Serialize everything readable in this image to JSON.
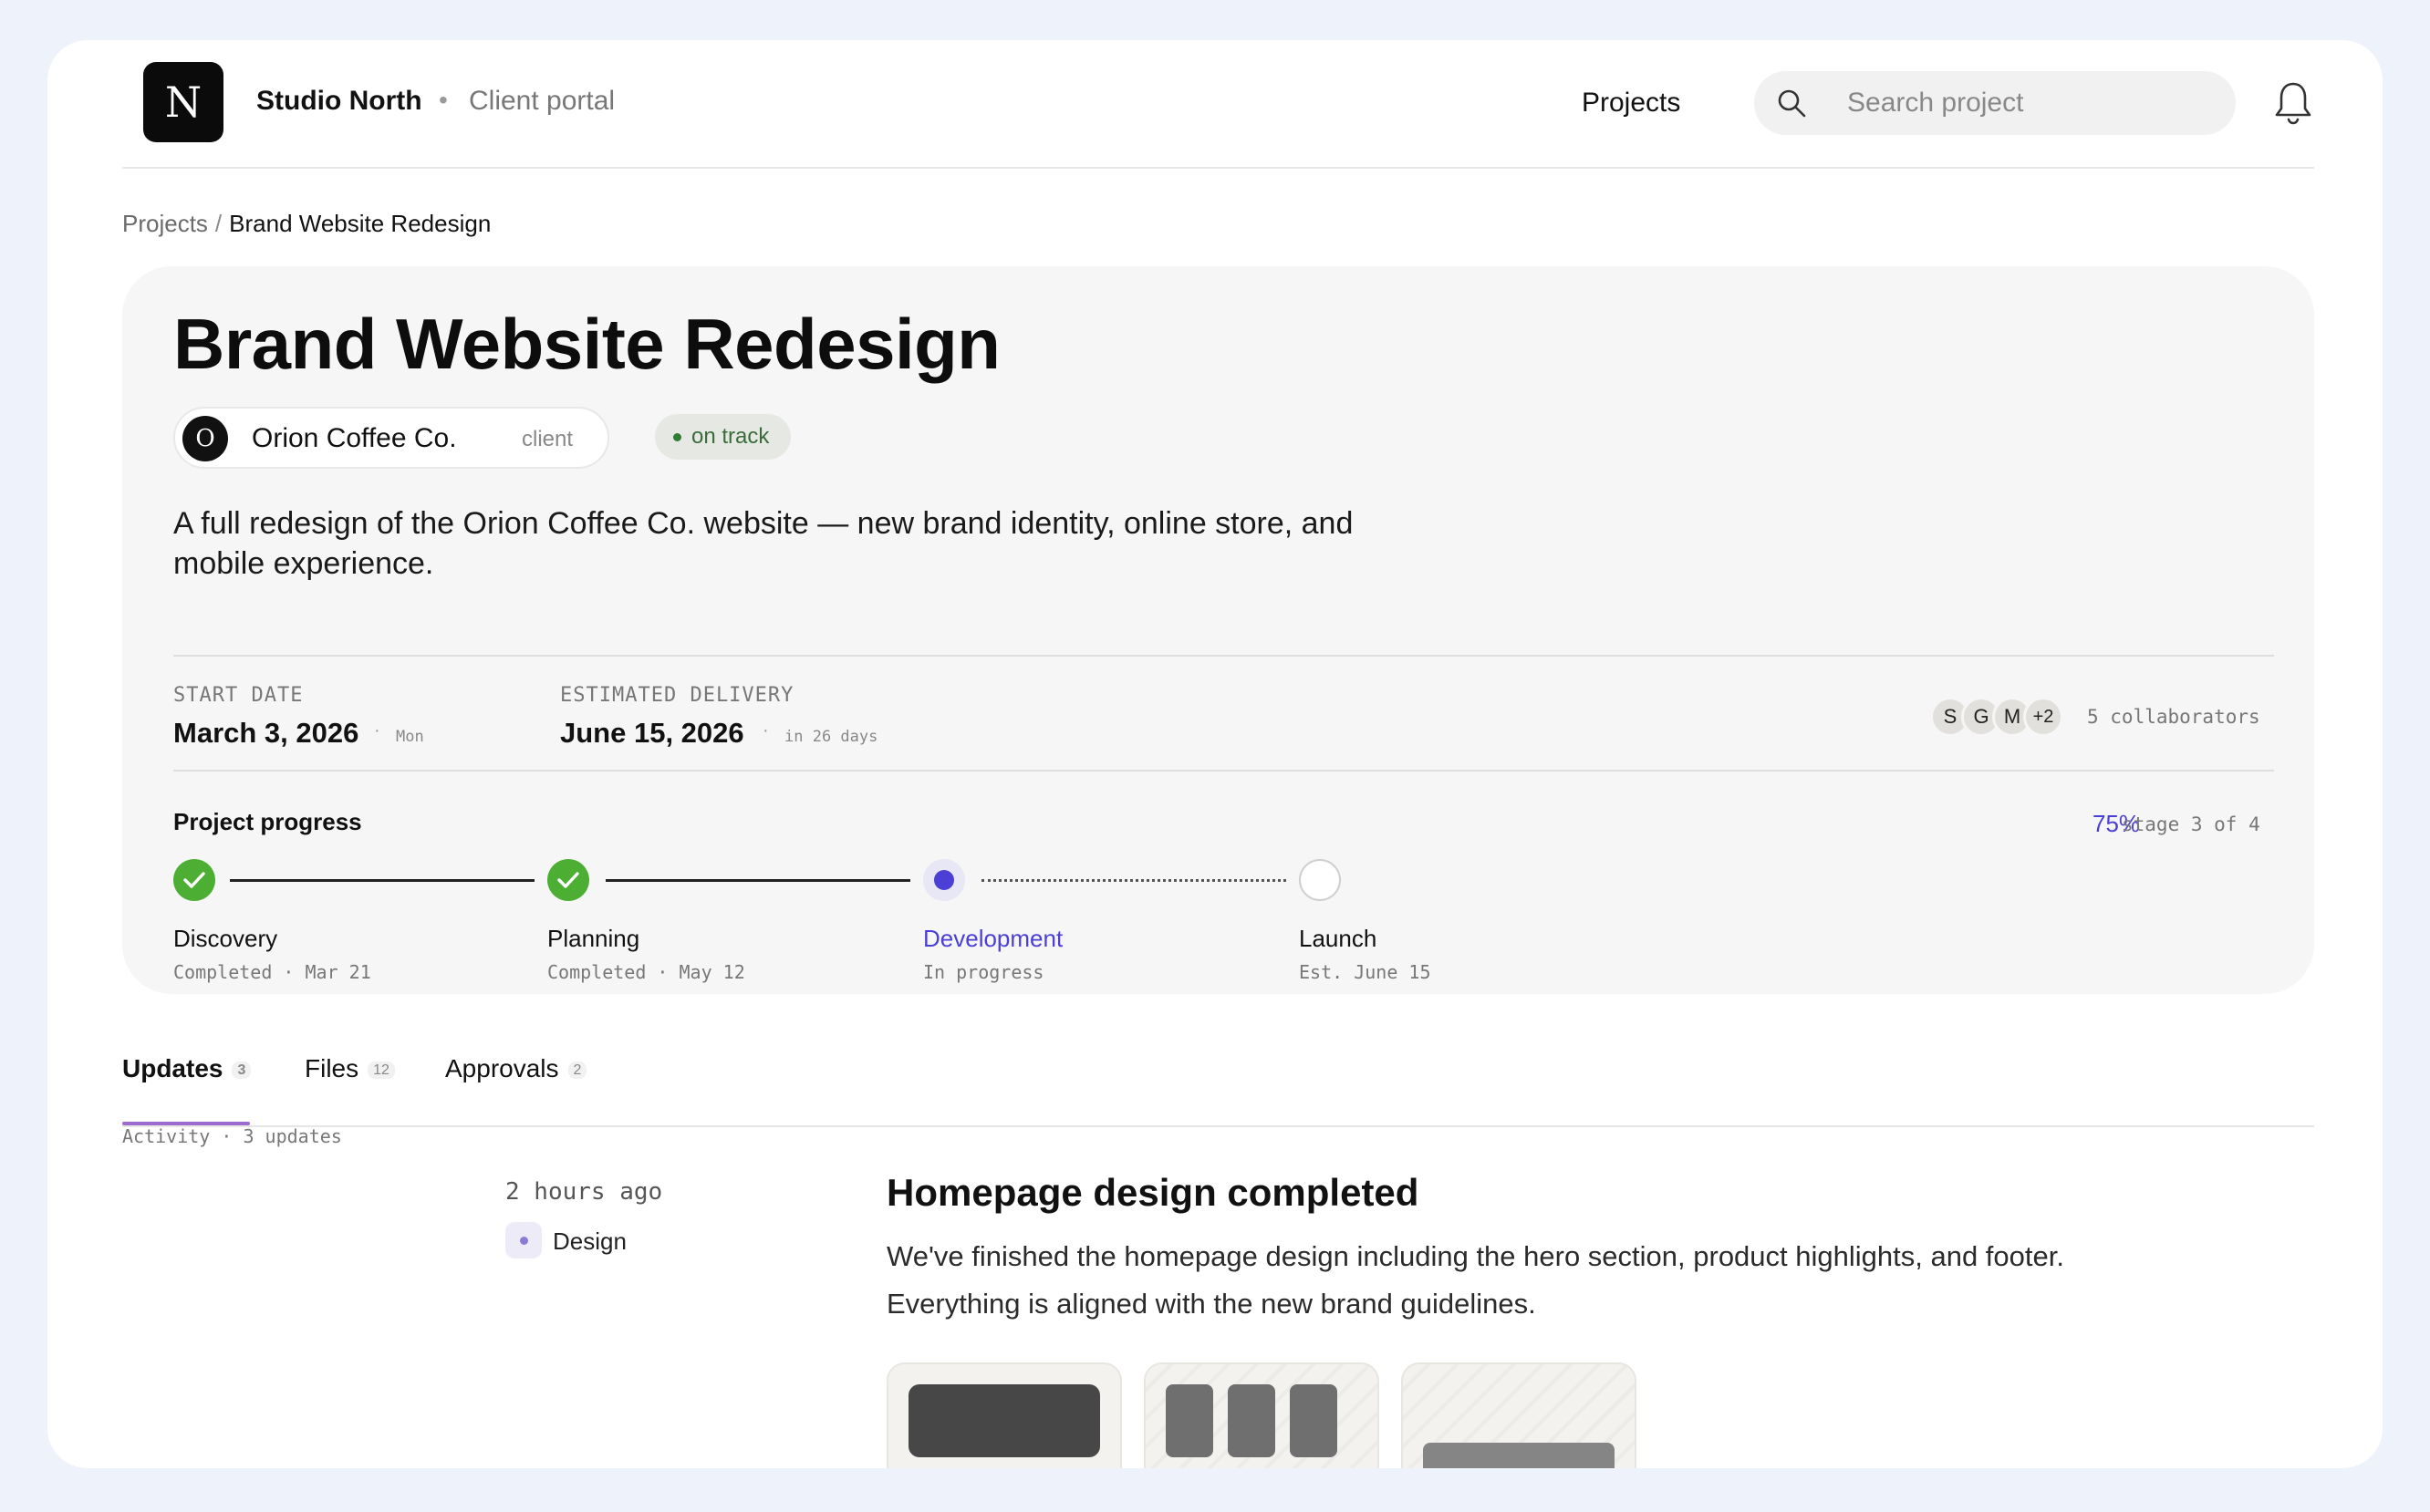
{
  "header": {
    "logo_letter": "N",
    "brand_name": "Studio North",
    "separator": "•",
    "portal_label": "Client portal",
    "nav_projects": "Projects",
    "search_placeholder": "Search project"
  },
  "breadcrumb": {
    "parent": "Projects",
    "separator": "/",
    "current": "Brand Website Redesign"
  },
  "project": {
    "title": "Brand Website Redesign",
    "client": {
      "avatar_letter": "O",
      "name": "Orion Coffee Co.",
      "tag": "client"
    },
    "status": "on track",
    "description": "A full redesign of the Orion Coffee Co. website — new brand identity, online store, and mobile experience.",
    "start": {
      "label": "START DATE",
      "value": "March 3, 2026",
      "note": "Mon"
    },
    "delivery": {
      "label": "ESTIMATED DELIVERY",
      "value": "June 15, 2026",
      "note": "in 26 days"
    },
    "dot": "·",
    "collaborators": {
      "avatars": [
        "S",
        "G",
        "M",
        "+2"
      ],
      "label": "5 collaborators"
    },
    "progress": {
      "label": "Project progress",
      "percent": "75%",
      "stage": "stage 3 of 4",
      "steps": [
        {
          "name": "Discovery",
          "sub": "Completed · Mar 21",
          "state": "done"
        },
        {
          "name": "Planning",
          "sub": "Completed · May 12",
          "state": "done"
        },
        {
          "name": "Development",
          "sub": "In progress",
          "state": "current"
        },
        {
          "name": "Launch",
          "sub": "Est. June 15",
          "state": "future"
        }
      ]
    }
  },
  "tabs": [
    {
      "label": "Updates",
      "count": "3",
      "active": true
    },
    {
      "label": "Files",
      "count": "12",
      "active": false
    },
    {
      "label": "Approvals",
      "count": "2",
      "active": false
    }
  ],
  "activity": {
    "label": "Activity · 3 updates",
    "update": {
      "time": "2 hours ago",
      "tag": "Design",
      "title": "Homepage design completed",
      "body": "We've finished the homepage design including the hero section, product highlights, and footer. Everything is aligned with the new brand guidelines."
    }
  },
  "colors": {
    "accent": "#4b3fd6",
    "success": "#4caf33",
    "status_text": "#3a6b3a",
    "tab_underline": "#9d6ad0"
  }
}
